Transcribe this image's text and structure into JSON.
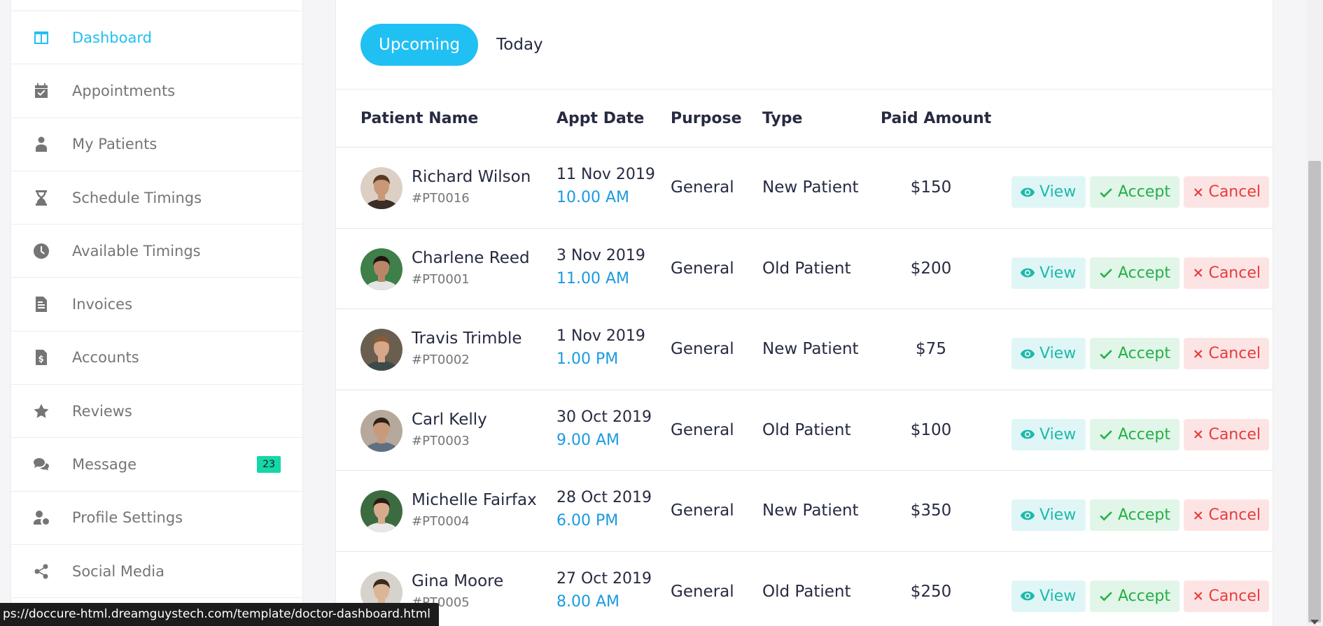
{
  "sidebar": {
    "items": [
      {
        "label": "Dashboard",
        "icon": "columns-icon",
        "active": true
      },
      {
        "label": "Appointments",
        "icon": "calendar-check-icon"
      },
      {
        "label": "My Patients",
        "icon": "user-injured-icon"
      },
      {
        "label": "Schedule Timings",
        "icon": "hourglass-icon"
      },
      {
        "label": "Available Timings",
        "icon": "clock-icon"
      },
      {
        "label": "Invoices",
        "icon": "file-invoice-icon"
      },
      {
        "label": "Accounts",
        "icon": "file-invoice-dollar-icon"
      },
      {
        "label": "Reviews",
        "icon": "star-icon"
      },
      {
        "label": "Message",
        "icon": "comments-icon",
        "badge": "23"
      },
      {
        "label": "Profile Settings",
        "icon": "user-cog-icon"
      },
      {
        "label": "Social Media",
        "icon": "share-alt-icon"
      }
    ]
  },
  "tabs": {
    "upcoming": "Upcoming",
    "today": "Today"
  },
  "table": {
    "headers": {
      "patient_name": "Patient Name",
      "appt_date": "Appt Date",
      "purpose": "Purpose",
      "type": "Type",
      "paid_amount": "Paid Amount"
    },
    "rows": [
      {
        "name": "Richard Wilson",
        "id": "#PT0016",
        "date": "11 Nov 2019",
        "time": "10.00 AM",
        "purpose": "General",
        "type": "New Patient",
        "amount": "$150"
      },
      {
        "name": "Charlene Reed",
        "id": "#PT0001",
        "date": "3 Nov 2019",
        "time": "11.00 AM",
        "purpose": "General",
        "type": "Old Patient",
        "amount": "$200"
      },
      {
        "name": "Travis Trimble",
        "id": "#PT0002",
        "date": "1 Nov 2019",
        "time": "1.00 PM",
        "purpose": "General",
        "type": "New Patient",
        "amount": "$75"
      },
      {
        "name": "Carl Kelly",
        "id": "#PT0003",
        "date": "30 Oct 2019",
        "time": "9.00 AM",
        "purpose": "General",
        "type": "Old Patient",
        "amount": "$100"
      },
      {
        "name": "Michelle Fairfax",
        "id": "#PT0004",
        "date": "28 Oct 2019",
        "time": "6.00 PM",
        "purpose": "General",
        "type": "New Patient",
        "amount": "$350"
      },
      {
        "name": "Gina Moore",
        "id": "#PT0005",
        "date": "27 Oct 2019",
        "time": "8.00 AM",
        "purpose": "General",
        "type": "Old Patient",
        "amount": "$250"
      }
    ],
    "actions": {
      "view": "View",
      "accept": "Accept",
      "cancel": "Cancel"
    }
  },
  "status_url": "ps://doccure-html.dreamguystech.com/template/doctor-dashboard.html",
  "colors": {
    "accent": "#20c0f3",
    "view": "#1db9aa",
    "accept": "#26af48",
    "cancel": "#e63c3c",
    "badge": "#15d7a8"
  }
}
